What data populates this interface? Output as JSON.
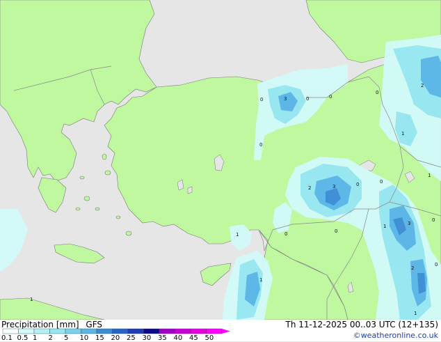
{
  "legend": {
    "title": "Precipitation [mm]",
    "model": "GFS",
    "run": "Th 11-12-2025 00..03 UTC (12+135)",
    "site": "©weatheronline.co.uk",
    "ticks": [
      "0.1",
      "0.5",
      "1",
      "2",
      "5",
      "10",
      "15",
      "20",
      "25",
      "30",
      "35",
      "40",
      "45",
      "50"
    ],
    "colors": [
      "#f5ffff",
      "#d2fafa",
      "#b4f0f5",
      "#96e6f0",
      "#78d2ee",
      "#5ab4e6",
      "#3c8cd2",
      "#2864c8",
      "#1e3cb4",
      "#0a0a8c",
      "#a000c8",
      "#c800dc",
      "#e600e6",
      "#ff00ff"
    ]
  },
  "map": {
    "colors": {
      "land": "#c0f8a0",
      "sea": "#e6e6e6",
      "border": "#8a8a8a",
      "coast": "#666666"
    },
    "labels": [
      "3",
      "0",
      "0",
      "0",
      "0",
      "2",
      "0",
      "2",
      "3",
      "0",
      "0",
      "1",
      "1",
      "1",
      "3",
      "0",
      "1",
      "1",
      "2",
      "0",
      "0",
      "0",
      "1",
      "1"
    ]
  }
}
